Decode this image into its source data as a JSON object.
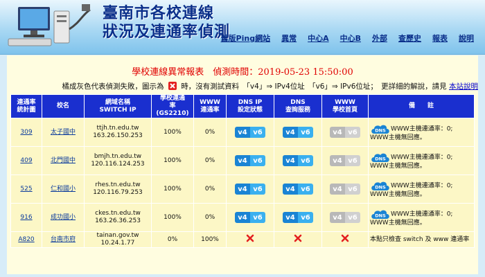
{
  "header": {
    "title_line1": "臺南市各校連線",
    "title_line2": "狀況及連通率偵測",
    "nav": [
      "舊版Ping網站",
      "異常",
      "中心A",
      "中心B",
      "外部",
      "查歷史",
      "報表",
      "說明"
    ]
  },
  "report": {
    "title": "學校連線異常報表　偵測時間：2019-05-23 15:50:00",
    "legend_a": "橘成灰色代表偵測失敗，圖示為",
    "legend_b": "時，沒有測試資料　「v4」⇒ IPv4位址　「v6」⇒ IPv6位址；　更詳細的解說，請見",
    "legend_link": "本站說明"
  },
  "columns": [
    "連通率\n統計圖",
    "校名",
    "網域名稱\nSWITCH IP",
    "學校連通\n率(GS2210)",
    "WWW\n連通率",
    "DNS IP\n設定狀態",
    "DNS\n查詢服務",
    "WWW\n學校首頁",
    "備　　註"
  ],
  "rows": [
    {
      "id": "309",
      "name": "太子國中",
      "domain": "ttjh.tn.edu.tw",
      "ip": "163.26.150.253",
      "school_rate": "100%",
      "www_rate": "0%",
      "dns_ip": "v4v6",
      "dns_query": "v4v6",
      "www_home": "off",
      "note_dns": "DNS",
      "note": "WWW主機連通率：0; WWW主機無回應。"
    },
    {
      "id": "409",
      "name": "北門國中",
      "domain": "bmjh.tn.edu.tw",
      "ip": "120.116.124.253",
      "school_rate": "100%",
      "www_rate": "0%",
      "dns_ip": "v4v6",
      "dns_query": "v4v6",
      "www_home": "off",
      "note_dns": "DNS",
      "note": "WWW主機連通率：0; WWW主機無回應。"
    },
    {
      "id": "525",
      "name": "仁和國小",
      "domain": "rhes.tn.edu.tw",
      "ip": "120.116.79.253",
      "school_rate": "100%",
      "www_rate": "0%",
      "dns_ip": "v4v6",
      "dns_query": "v4v6",
      "www_home": "off",
      "note_dns": "DNS",
      "note": "WWW主機連通率：0; WWW主機無回應。"
    },
    {
      "id": "916",
      "name": "成功國小",
      "domain": "ckes.tn.edu.tw",
      "ip": "163.26.36.253",
      "school_rate": "100%",
      "www_rate": "0%",
      "dns_ip": "v4v6",
      "dns_query": "v4v6",
      "www_home": "off",
      "note_dns": "DNS",
      "note": "WWW主機連通率：0; WWW主機無回應。"
    },
    {
      "id": "A820",
      "name": "台南市府",
      "domain": "tainan.gov.tw",
      "ip": "10.24.1.77",
      "school_rate": "0%",
      "www_rate": "100%",
      "dns_ip": "x",
      "dns_query": "x",
      "www_home": "x",
      "note_dns": "",
      "note": "本點只檢查 switch 及 www 連通率"
    }
  ],
  "colors": {
    "header_blue": "#1a2fcf",
    "row_bg": "#fcf7c6",
    "accent": "#0a2f8a",
    "error_red": "#e00000"
  }
}
